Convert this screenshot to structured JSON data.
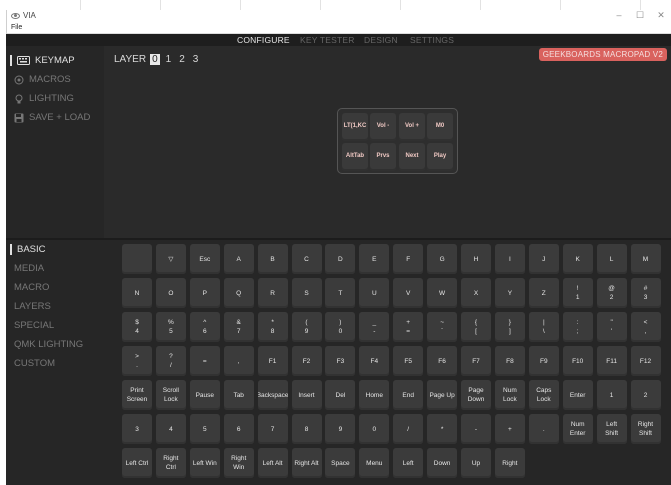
{
  "window": {
    "title": "VIA",
    "menu": [
      "File"
    ],
    "controls": [
      "–",
      "☐",
      "✕"
    ]
  },
  "topnav": {
    "tabs": [
      {
        "label": "CONFIGURE",
        "active": true
      },
      {
        "label": "KEY TESTER",
        "active": false
      },
      {
        "label": "DESIGN",
        "active": false
      },
      {
        "label": "SETTINGS",
        "active": false
      }
    ]
  },
  "sidebar_top": {
    "items": [
      {
        "label": "KEYMAP",
        "icon": "keyboard-icon",
        "active": true
      },
      {
        "label": "MACROS",
        "icon": "macro-icon",
        "active": false
      },
      {
        "label": "LIGHTING",
        "icon": "bulb-icon",
        "active": false
      },
      {
        "label": "SAVE + LOAD",
        "icon": "save-icon",
        "active": false
      }
    ]
  },
  "layer": {
    "label": "LAYER",
    "layers": [
      "0",
      "1",
      "2",
      "3"
    ],
    "selected": "0"
  },
  "device_badge": "GEEKBOARDS MACROPAD V2",
  "macropad_keys": [
    [
      "LT(1,KC",
      "Vol -",
      "Vol +",
      "M0"
    ],
    [
      "AltTab",
      "Prvs",
      "Next",
      "Play"
    ]
  ],
  "sidebar_bottom": {
    "items": [
      {
        "label": "BASIC",
        "active": true
      },
      {
        "label": "MEDIA",
        "active": false
      },
      {
        "label": "MACRO",
        "active": false
      },
      {
        "label": "LAYERS",
        "active": false
      },
      {
        "label": "SPECIAL",
        "active": false
      },
      {
        "label": "QMK LIGHTING",
        "active": false
      },
      {
        "label": "CUSTOM",
        "active": false
      }
    ]
  },
  "keycode_rows": [
    [
      "",
      "▽",
      "Esc",
      "A",
      "B",
      "C",
      "D",
      "E",
      "F",
      "G",
      "H",
      "I",
      "J",
      "K",
      "L",
      "M"
    ],
    [
      "N",
      "O",
      "P",
      "Q",
      "R",
      "S",
      "T",
      "U",
      "V",
      "W",
      "X",
      "Y",
      "Z",
      "!\n1",
      "@\n2",
      "#\n3"
    ],
    [
      "$\n4",
      "%\n5",
      "^\n6",
      "&\n7",
      "*\n8",
      "(\n9",
      ")\n0",
      "_\n-",
      "+\n=",
      "~\n`",
      "{\n[",
      "}\n]",
      "|\n\\",
      ":\n;",
      "\"\n'",
      "<\n,"
    ],
    [
      ">\n.",
      "?\n/",
      "=",
      ",",
      "F1",
      "F2",
      "F3",
      "F4",
      "F5",
      "F6",
      "F7",
      "F8",
      "F9",
      "F10",
      "F11",
      "F12"
    ],
    [
      "Print\nScreen",
      "Scroll\nLock",
      "Pause",
      "Tab",
      "Backspace",
      "Insert",
      "Del",
      "Home",
      "End",
      "Page Up",
      "Page\nDown",
      "Num\nLock",
      "Caps\nLock",
      "Enter",
      "1",
      "2"
    ],
    [
      "3",
      "4",
      "5",
      "6",
      "7",
      "8",
      "9",
      "0",
      "/",
      "*",
      "-",
      "+",
      ".",
      "Num\nEnter",
      "Left\nShift",
      "Right\nShift"
    ],
    [
      "Left Ctrl",
      "Right\nCtrl",
      "Left Win",
      "Right\nWin",
      "Left Alt",
      "Right Alt",
      "Space",
      "Menu",
      "Left",
      "Down",
      "Up",
      "Right"
    ]
  ]
}
